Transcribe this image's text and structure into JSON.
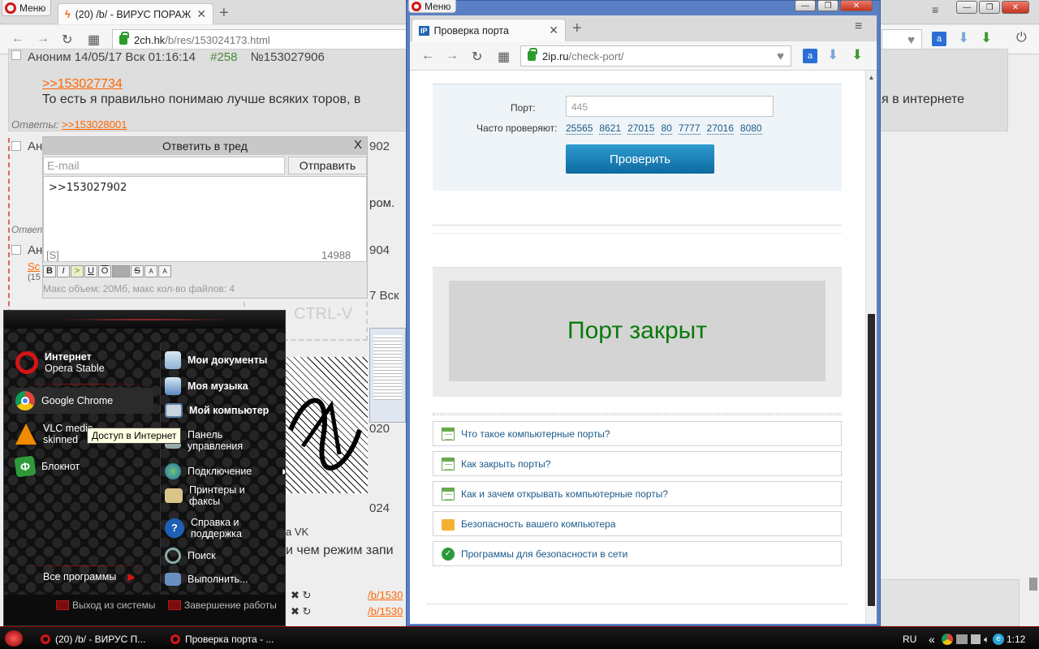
{
  "bg_browser": {
    "menu_label": "Меню",
    "tab_title": "(20) /b/ - ВИРУС ПОРАЖ",
    "address_domain": "2ch.hk",
    "address_path": "/b/res/153024173.html",
    "post_header": "Аноним 14/05/17 Вск 01:16:14",
    "post_num": "#258",
    "post_id": "№153027906",
    "reply_link": ">>153027734",
    "post_text": "То есть я правильно понимаю лучше всяких торов, в",
    "post_text_right": "я в интернете",
    "answers_label": "Ответы:",
    "answers_link": ">>153028001",
    "frag_902": "902",
    "frag_rom": "ром.",
    "frag_904": "904",
    "frag_vsk": "7 Вск",
    "frag_ctrl": "CTRL-V",
    "frag_020": "020",
    "frag_024": "024",
    "frag_vk": "a VK",
    "frag_zap": "и чем режим запи",
    "frag_otvet": "Ответ",
    "frag_an1": "Ан",
    "frag_an2": "Ан",
    "frag_sc": "Sc",
    "frag_15": "(15",
    "link_b1": "/b/1530",
    "link_b2": "/b/1530"
  },
  "reply_form": {
    "title": "Ответить в тред",
    "close": "X",
    "email_placeholder": "E-mail",
    "send_label": "Отправить",
    "text_value": ">>153027902",
    "sage": "[S]",
    "counter": "14988",
    "markup_buttons": [
      "B",
      "I",
      ">",
      "U",
      "O",
      " ",
      "S",
      "A",
      "A"
    ],
    "limits": "Макс объем: 20Мб, макс кол-во файлов: 4"
  },
  "fg_browser": {
    "menu_label": "Меню",
    "tab_title": "Проверка порта",
    "tab_favicon": "IP",
    "address_domain": "2ip.ru",
    "address_path": "/check-port/",
    "port_label": "Порт:",
    "port_value": "445",
    "often_label": "Часто проверяют:",
    "often_ports": [
      "25565",
      "8621",
      "27015",
      "80",
      "7777",
      "27016",
      "8080"
    ],
    "check_button": "Проверить",
    "result": "Порт закрыт",
    "result_color": "#0a7a0a",
    "links": [
      {
        "icon": "doc-icon",
        "label": "Что такое компьютерные порты?"
      },
      {
        "icon": "doc-icon",
        "label": "Как закрыть порты?"
      },
      {
        "icon": "doc-icon",
        "label": "Как и зачем открывать компьютерные порты?"
      },
      {
        "icon": "lock-icon",
        "label": "Безопасность вашего компьютера"
      },
      {
        "icon": "shield-icon",
        "label": "Программы для безопасности в сети"
      }
    ]
  },
  "start_menu": {
    "pinned": [
      {
        "title": "Интернет",
        "sub": "Opera Stable",
        "icon": "opera-icon"
      },
      {
        "title": "Google Chrome",
        "icon": "chrome-icon"
      },
      {
        "title": "VLC media",
        "sub": "skinned",
        "icon": "vlc-icon"
      },
      {
        "title": "Блокнот",
        "icon": "notepad-icon"
      }
    ],
    "all_programs": "Все программы",
    "right": [
      "Мои документы",
      "Моя музыка",
      "Мой компьютер",
      "Панель управления",
      "Подключение",
      "Принтеры и факсы",
      "Справка и поддержка",
      "Поиск",
      "Выполнить..."
    ],
    "logoff": "Выход из системы",
    "shutdown": "Завершение работы",
    "tooltip": "Доступ в Интернет"
  },
  "taskbar": {
    "items": [
      "(20) /b/ - ВИРУС П...",
      "Проверка порта - ..."
    ],
    "lang": "RU",
    "chevron": "«",
    "clock": "1:12"
  }
}
